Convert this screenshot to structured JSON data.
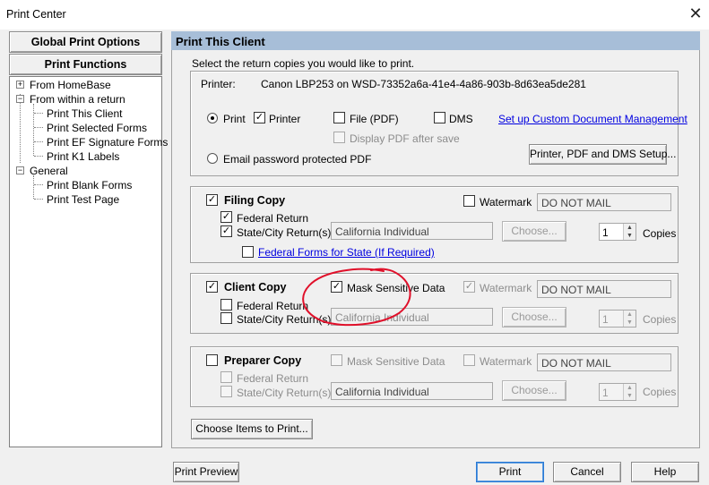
{
  "window": {
    "title": "Print Center",
    "close": "✕"
  },
  "nav": {
    "global_print_options": "Global Print Options",
    "print_functions": "Print Functions",
    "tree": {
      "from_homebase": "From HomeBase",
      "from_within_return": "From within a return",
      "print_this_client": "Print This Client",
      "print_selected_forms": "Print Selected Forms",
      "print_ef_signature_forms": "Print EF Signature Forms",
      "print_k1_labels": "Print K1 Labels",
      "general": "General",
      "print_blank_forms": "Print Blank Forms",
      "print_test_page": "Print Test Page",
      "expand": "+",
      "collapse": "−"
    }
  },
  "panel": {
    "title": "Print This Client",
    "instruction": "Select the return copies you would like to print.",
    "printer_label": "Printer:",
    "printer_name": "Canon LBP253 on WSD-73352a6a-41e4-4a86-903b-8d63ea5de281",
    "print_radio": "Print",
    "printer_cb": "Printer",
    "file_pdf": "File (PDF)",
    "dms": "DMS",
    "setup_dms_link": "Set up Custom Document Management",
    "display_pdf": "Display PDF after save",
    "email_pdf": "Email password protected PDF",
    "setup_button": "Printer, PDF and DMS Setup...",
    "check": "✓"
  },
  "filing": {
    "title": "Filing Copy",
    "watermark": "Watermark",
    "watermark_text": "DO NOT MAIL",
    "federal": "Federal Return",
    "state": "State/City Return(s)",
    "state_value": "California Individual",
    "choose": "Choose...",
    "copies_value": "1",
    "copies": "Copies",
    "federal_forms_link": "Federal Forms for State (If Required)"
  },
  "client": {
    "title": "Client Copy",
    "mask": "Mask Sensitive Data",
    "watermark": "Watermark",
    "watermark_text": "DO NOT MAIL",
    "federal": "Federal Return",
    "state": "State/City Return(s)",
    "state_value": "California Individual",
    "choose": "Choose...",
    "copies_value": "1",
    "copies": "Copies"
  },
  "preparer": {
    "title": "Preparer Copy",
    "mask": "Mask Sensitive Data",
    "watermark": "Watermark",
    "watermark_text": "DO NOT MAIL",
    "federal": "Federal Return",
    "state": "State/City Return(s)",
    "state_value": "California Individual",
    "choose": "Choose...",
    "copies_value": "1",
    "copies": "Copies"
  },
  "footer": {
    "choose_items": "Choose Items to Print...",
    "print_preview": "Print Preview",
    "print": "Print",
    "cancel": "Cancel",
    "help": "Help"
  },
  "colors": {
    "header_bg": "#a7bed8",
    "link": "#0000e0",
    "annotation": "#e0102a"
  }
}
